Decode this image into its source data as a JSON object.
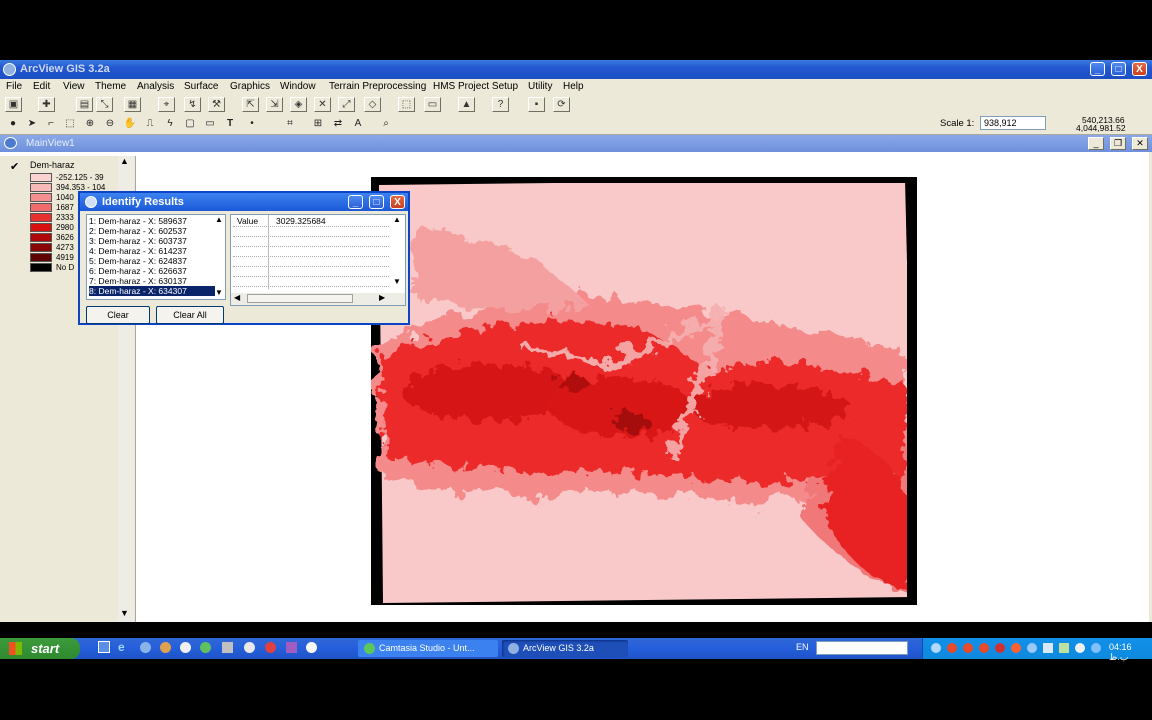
{
  "app": {
    "title": "ArcView GIS 3.2a",
    "min": "_",
    "max": "□",
    "close": "X"
  },
  "menu": [
    "File",
    "Edit",
    "View",
    "Theme",
    "Analysis",
    "Surface",
    "Graphics",
    "Window",
    "Terrain Preprocessing",
    "HMS Project Setup",
    "Utility",
    "Help"
  ],
  "toolbar2": {
    "scale_label": "Scale 1:",
    "scale_value": "938,912",
    "coord_x": "540,213.66",
    "coord_y": "4,044,981.52"
  },
  "view": {
    "title": "MainView1"
  },
  "toc": {
    "theme_name": "Dem-haraz",
    "legend": [
      {
        "label": "-252.125 - 39",
        "color": "#fbd2d2"
      },
      {
        "label": "394.353 - 104",
        "color": "#f7b8b8"
      },
      {
        "label": "1040",
        "color": "#f49090"
      },
      {
        "label": "1687",
        "color": "#f06b6b"
      },
      {
        "label": "2333",
        "color": "#e83030"
      },
      {
        "label": "2980",
        "color": "#d81010"
      },
      {
        "label": "3626",
        "color": "#b00808"
      },
      {
        "label": "4273",
        "color": "#8a0505"
      },
      {
        "label": "4919",
        "color": "#600303"
      },
      {
        "label": "No D",
        "color": "#000000"
      }
    ]
  },
  "identify": {
    "title": "Identify Results",
    "items": [
      "1:  Dem-haraz - X: 589637",
      "2:  Dem-haraz - X: 602537",
      "3:  Dem-haraz - X: 603737",
      "4:  Dem-haraz - X: 614237",
      "5:  Dem-haraz - X: 624837",
      "6:  Dem-haraz - X: 626637",
      "7:  Dem-haraz - X: 630137",
      "8:  Dem-haraz - X: 634307"
    ],
    "attr_name": "Value",
    "attr_value": "3029.325684",
    "clear_label": "Clear",
    "clear_all_label": "Clear All"
  },
  "taskbar": {
    "start": "start",
    "tasks": [
      "Camtasia Studio - Unt...",
      "ArcView GIS 3.2a"
    ],
    "lang": "EN",
    "clock": "04:16 ب.ظ"
  }
}
